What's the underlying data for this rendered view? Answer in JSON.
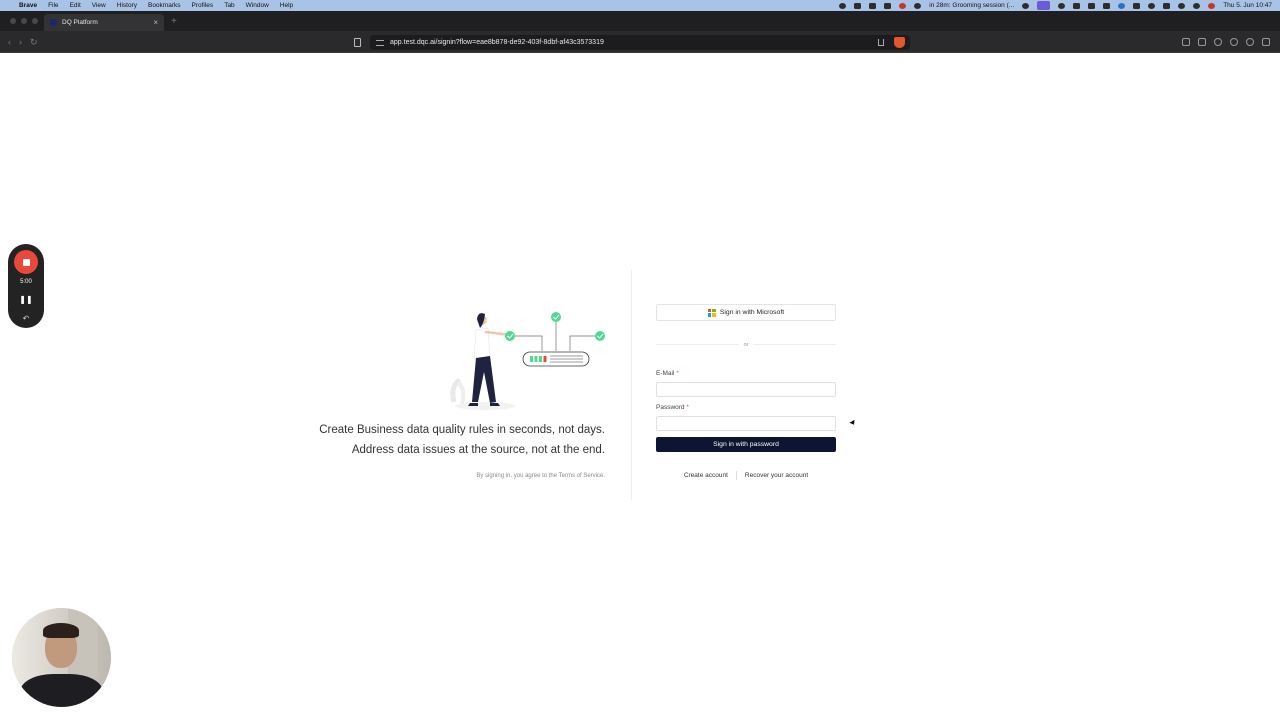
{
  "menubar": {
    "app_name": "Brave",
    "items": [
      "File",
      "Edit",
      "View",
      "History",
      "Bookmarks",
      "Profiles",
      "Tab",
      "Window",
      "Help"
    ],
    "event": "in 28m: Grooming session (...",
    "clock": "Thu 5. Jun  10:47"
  },
  "browser": {
    "tab_title": "DQ Platform",
    "url": "app.test.dqc.ai/signin?flow=eae8b878-de92-403f-8dbf-af43c3573319"
  },
  "recorder": {
    "time": "5:00"
  },
  "hero": {
    "tagline_1": "Create Business data quality rules in seconds, not days.",
    "tagline_2": "Address data issues at the source, not at the end.",
    "terms": "By signing in, you agree to the Terms of Service."
  },
  "form": {
    "microsoft_label": "Sign in with Microsoft",
    "or_label": "or",
    "email_label": "E-Mail",
    "password_label": "Password",
    "required_mark": "*",
    "email_value": "",
    "password_value": "",
    "submit_label": "Sign in with password",
    "create_account": "Create account",
    "recover_account": "Recover your account"
  },
  "colors": {
    "primary": "#0e1530",
    "accent_green": "#4ddb8f",
    "record_red": "#e8493a"
  }
}
